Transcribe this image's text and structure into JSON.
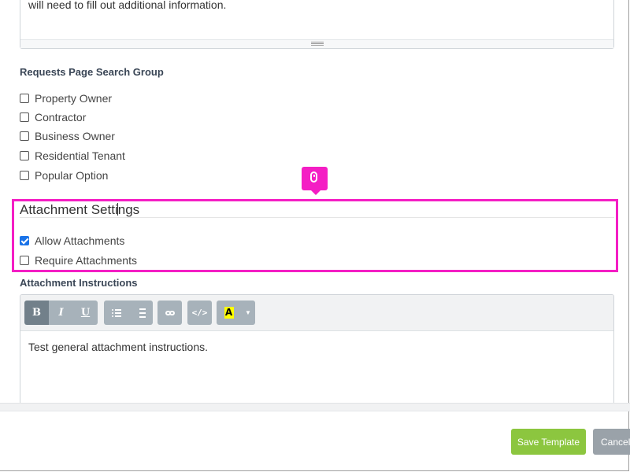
{
  "top_editor": {
    "text": "will need to fill out additional information."
  },
  "search_group": {
    "label": "Requests Page Search Group",
    "options": [
      {
        "label": "Property Owner",
        "checked": false
      },
      {
        "label": "Contractor",
        "checked": false
      },
      {
        "label": "Business Owner",
        "checked": false
      },
      {
        "label": "Residential Tenant",
        "checked": false
      },
      {
        "label": "Popular Option",
        "checked": false
      }
    ]
  },
  "attachment_settings": {
    "heading_before_cursor": "Attachment Setti",
    "heading_after_cursor": "ngs",
    "options": [
      {
        "label": "Allow Attachments",
        "checked": true
      },
      {
        "label": "Require Attachments",
        "checked": false
      }
    ]
  },
  "attachment_instructions": {
    "label": "Attachment Instructions",
    "toolbar": {
      "bold": "B",
      "italic": "I",
      "underline": "U",
      "code": "</>",
      "highlight": "A",
      "dropdown": "▼"
    },
    "body": "Test general attachment instructions."
  },
  "footer": {
    "save_label": "Save Template",
    "cancel_label": "Cancel"
  },
  "colors": {
    "highlight": "#f41ec4",
    "save_button": "#8cc63f",
    "cancel_button": "#9aa2a9",
    "checkbox_checked": "#1a73e8"
  },
  "icons": {
    "click_marker": "mouse-icon"
  }
}
